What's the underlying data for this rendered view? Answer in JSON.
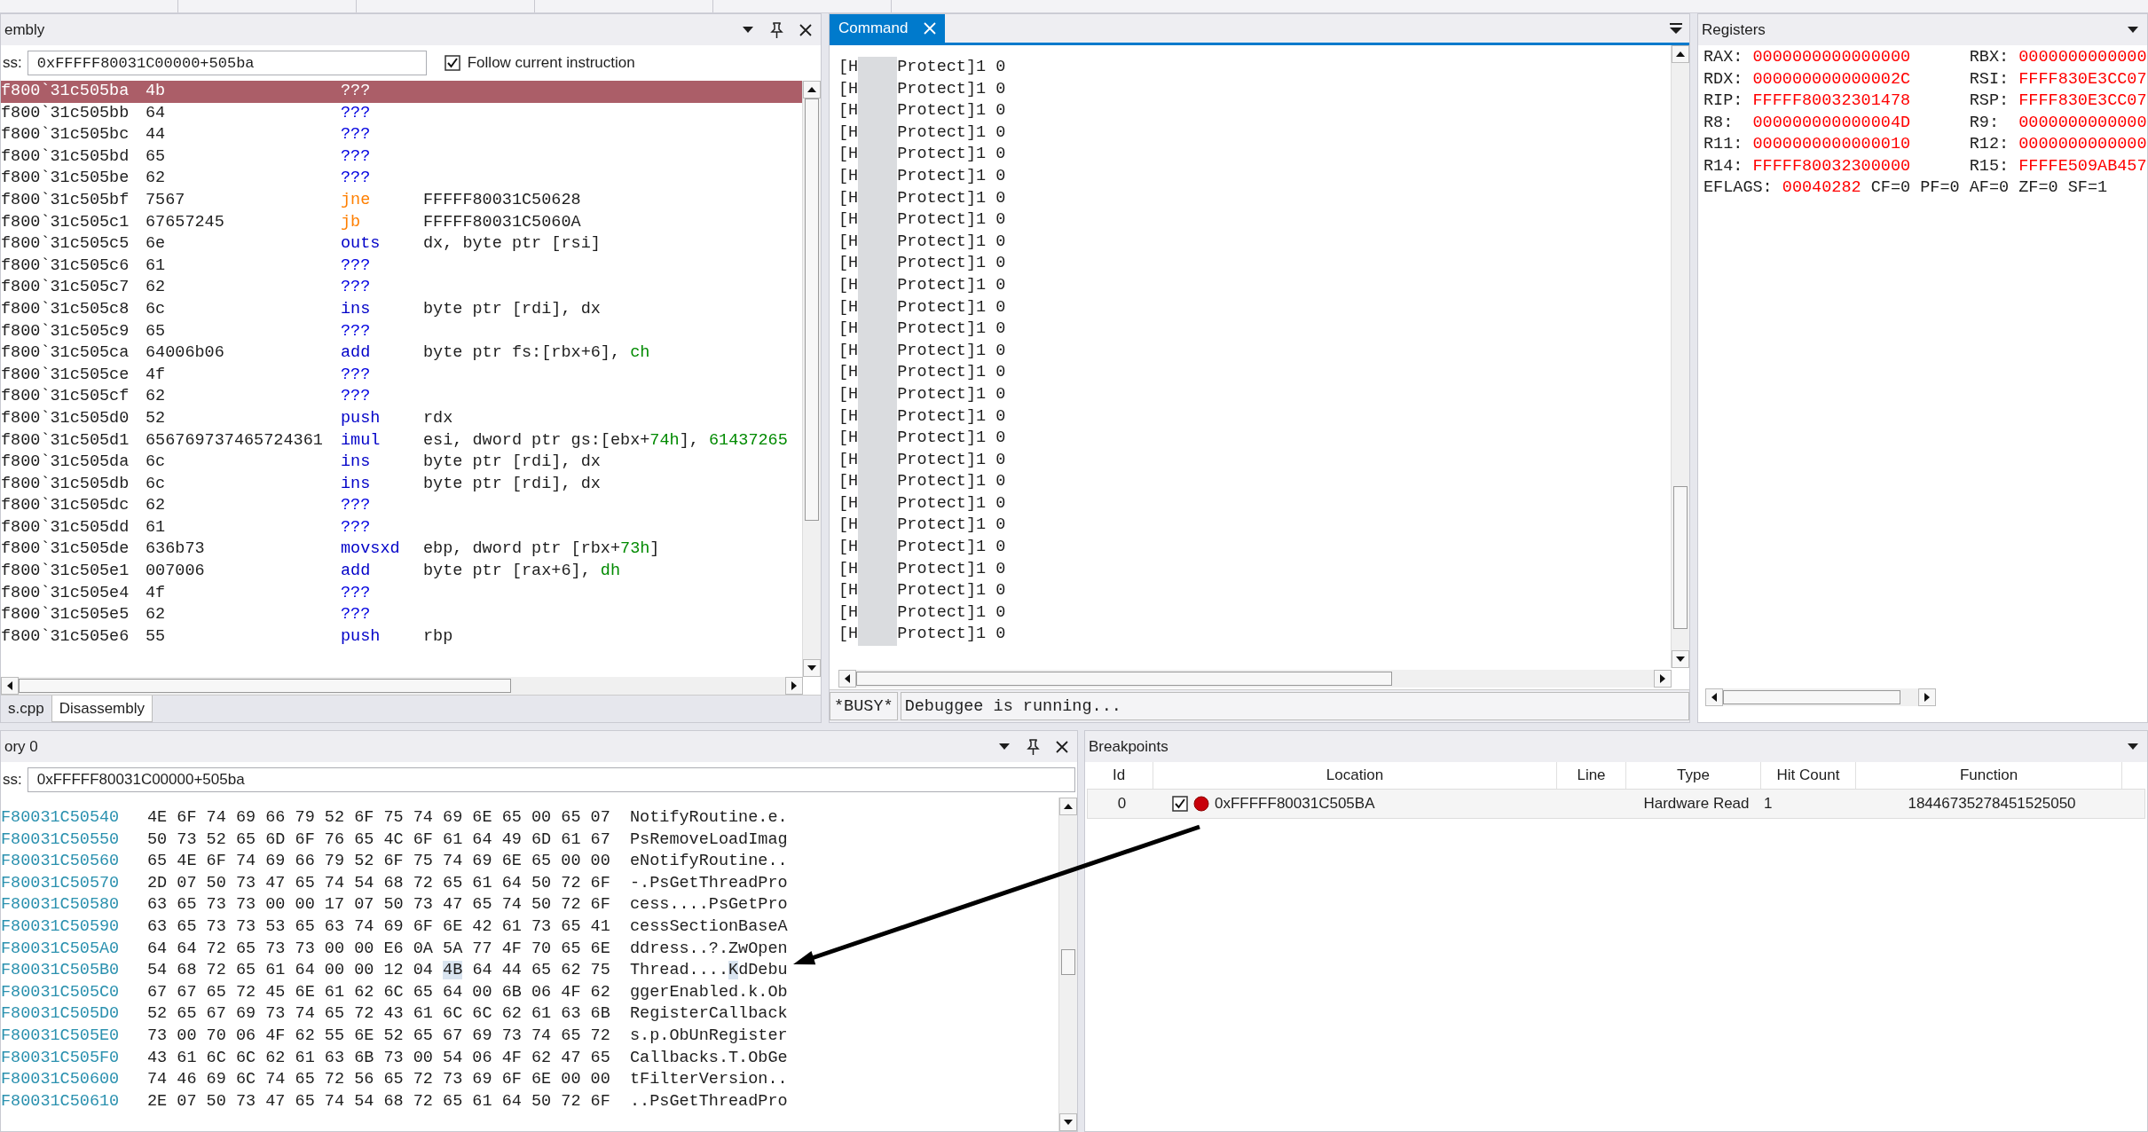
{
  "disassembly": {
    "title": "embly",
    "address_label": "ss:",
    "address": "0xFFFFF80031C00000+505ba",
    "follow": {
      "label": "Follow current instruction",
      "checked": true
    },
    "rows": [
      {
        "address": "f800`31c505ba",
        "bytes": "4b",
        "mnemonic": "???",
        "kind": "unknown",
        "selected": true
      },
      {
        "address": "f800`31c505bb",
        "bytes": "64",
        "mnemonic": "???",
        "kind": "unknown",
        "selected": false
      },
      {
        "address": "f800`31c505bc",
        "bytes": "44",
        "mnemonic": "???",
        "kind": "unknown",
        "selected": false
      },
      {
        "address": "f800`31c505bd",
        "bytes": "65",
        "mnemonic": "???",
        "kind": "unknown",
        "selected": false
      },
      {
        "address": "f800`31c505be",
        "bytes": "62",
        "mnemonic": "???",
        "kind": "unknown",
        "selected": false
      },
      {
        "address": "f800`31c505bf",
        "bytes": "7567",
        "mnemonic": "jne",
        "kind": "jump",
        "operands": [
          {
            "text": "FFFFF80031C50628",
            "kind": "plain"
          }
        ],
        "selected": false
      },
      {
        "address": "f800`31c505c1",
        "bytes": "67657245",
        "mnemonic": "jb",
        "kind": "jump",
        "operands": [
          {
            "text": "FFFFF80031C5060A",
            "kind": "plain"
          }
        ],
        "selected": false
      },
      {
        "address": "f800`31c505c5",
        "bytes": "6e",
        "mnemonic": "outs",
        "kind": "op",
        "operands": [
          {
            "text": "dx, byte ptr [rsi]",
            "kind": "plain"
          }
        ],
        "selected": false
      },
      {
        "address": "f800`31c505c6",
        "bytes": "61",
        "mnemonic": "???",
        "kind": "unknown",
        "selected": false
      },
      {
        "address": "f800`31c505c7",
        "bytes": "62",
        "mnemonic": "???",
        "kind": "unknown",
        "selected": false
      },
      {
        "address": "f800`31c505c8",
        "bytes": "6c",
        "mnemonic": "ins",
        "kind": "op",
        "operands": [
          {
            "text": "byte ptr [rdi], dx",
            "kind": "plain"
          }
        ],
        "selected": false
      },
      {
        "address": "f800`31c505c9",
        "bytes": "65",
        "mnemonic": "???",
        "kind": "unknown",
        "selected": false
      },
      {
        "address": "f800`31c505ca",
        "bytes": "64006b06",
        "mnemonic": "add",
        "kind": "op",
        "operands": [
          {
            "text": "byte ptr fs:[rbx+6], ",
            "kind": "plain"
          },
          {
            "text": "ch",
            "kind": "accent"
          }
        ],
        "selected": false
      },
      {
        "address": "f800`31c505ce",
        "bytes": "4f",
        "mnemonic": "???",
        "kind": "unknown",
        "selected": false
      },
      {
        "address": "f800`31c505cf",
        "bytes": "62",
        "mnemonic": "???",
        "kind": "unknown",
        "selected": false
      },
      {
        "address": "f800`31c505d0",
        "bytes": "52",
        "mnemonic": "push",
        "kind": "op",
        "operands": [
          {
            "text": "rdx",
            "kind": "plain"
          }
        ],
        "selected": false
      },
      {
        "address": "f800`31c505d1",
        "bytes": "656769737465724361",
        "mnemonic": "imul",
        "kind": "op",
        "operands": [
          {
            "text": "esi, dword ptr gs:[ebx+",
            "kind": "plain"
          },
          {
            "text": "74h",
            "kind": "accent"
          },
          {
            "text": "], ",
            "kind": "plain"
          },
          {
            "text": "61437265",
            "kind": "accent"
          }
        ],
        "selected": false
      },
      {
        "address": "f800`31c505da",
        "bytes": "6c",
        "mnemonic": "ins",
        "kind": "op",
        "operands": [
          {
            "text": "byte ptr [rdi], dx",
            "kind": "plain"
          }
        ],
        "selected": false
      },
      {
        "address": "f800`31c505db",
        "bytes": "6c",
        "mnemonic": "ins",
        "kind": "op",
        "operands": [
          {
            "text": "byte ptr [rdi], dx",
            "kind": "plain"
          }
        ],
        "selected": false
      },
      {
        "address": "f800`31c505dc",
        "bytes": "62",
        "mnemonic": "???",
        "kind": "unknown",
        "selected": false
      },
      {
        "address": "f800`31c505dd",
        "bytes": "61",
        "mnemonic": "???",
        "kind": "unknown",
        "selected": false
      },
      {
        "address": "f800`31c505de",
        "bytes": "636b73",
        "mnemonic": "movsxd",
        "kind": "op",
        "operands": [
          {
            "text": "ebp, dword ptr [rbx+",
            "kind": "plain"
          },
          {
            "text": "73h",
            "kind": "accent"
          },
          {
            "text": "]",
            "kind": "plain"
          }
        ],
        "selected": false
      },
      {
        "address": "f800`31c505e1",
        "bytes": "007006",
        "mnemonic": "add",
        "kind": "op",
        "operands": [
          {
            "text": "byte ptr [rax+6], ",
            "kind": "plain"
          },
          {
            "text": "dh",
            "kind": "accent"
          }
        ],
        "selected": false
      },
      {
        "address": "f800`31c505e4",
        "bytes": "4f",
        "mnemonic": "???",
        "kind": "unknown",
        "selected": false
      },
      {
        "address": "f800`31c505e5",
        "bytes": "62",
        "mnemonic": "???",
        "kind": "unknown",
        "selected": false
      },
      {
        "address": "f800`31c505e6",
        "bytes": "55",
        "mnemonic": "push",
        "kind": "op",
        "operands": [
          {
            "text": "rbp",
            "kind": "plain"
          }
        ],
        "selected": false
      }
    ],
    "tabs": [
      {
        "label": "s.cpp",
        "selected": false
      },
      {
        "label": "Disassembly",
        "selected": true
      }
    ]
  },
  "command": {
    "tab": {
      "label": "Command",
      "selected": true
    },
    "lines": [
      {
        "start": "[H",
        "end": "Protect]1 0"
      },
      {
        "start": "[H",
        "end": "Protect]1 0"
      },
      {
        "start": "[H",
        "end": "Protect]1 0"
      },
      {
        "start": "[H",
        "end": "Protect]1 0"
      },
      {
        "start": "[H",
        "end": "Protect]1 0"
      },
      {
        "start": "[H",
        "end": "Protect]1 0"
      },
      {
        "start": "[H",
        "end": "Protect]1 0"
      },
      {
        "start": "[H",
        "end": "Protect]1 0"
      },
      {
        "start": "[H",
        "end": "Protect]1 0"
      },
      {
        "start": "[H",
        "end": "Protect]1 0"
      },
      {
        "start": "[H",
        "end": "Protect]1 0"
      },
      {
        "start": "[H",
        "end": "Protect]1 0"
      },
      {
        "start": "[H",
        "end": "Protect]1 0"
      },
      {
        "start": "[H",
        "end": "Protect]1 0"
      },
      {
        "start": "[H",
        "end": "Protect]1 0"
      },
      {
        "start": "[H",
        "end": "Protect]1 0"
      },
      {
        "start": "[H",
        "end": "Protect]1 0"
      },
      {
        "start": "[H",
        "end": "Protect]1 0"
      },
      {
        "start": "[H",
        "end": "Protect]1 0"
      },
      {
        "start": "[H",
        "end": "Protect]1 0"
      },
      {
        "start": "[H",
        "end": "Protect]1 0"
      },
      {
        "start": "[H",
        "end": "Protect]1 0"
      },
      {
        "start": "[H",
        "end": "Protect]1 0"
      },
      {
        "start": "[H",
        "end": "Protect]1 0"
      },
      {
        "start": "[H",
        "end": "Protect]1 0"
      },
      {
        "start": "[H",
        "end": "Protect]1 0"
      },
      {
        "start": "[H",
        "end": "Protect]1 0"
      }
    ],
    "status": "*BUSY*",
    "message": "Debuggee is running..."
  },
  "registers": {
    "title": "Registers",
    "rows": [
      [
        {
          "name": "RAX:",
          "value": "0000000000000000"
        },
        {
          "name": "RBX:",
          "value": "0000000000000"
        }
      ],
      [
        {
          "name": "RDX:",
          "value": "000000000000002C"
        },
        {
          "name": "RSI:",
          "value": "FFFF830E3CC07"
        }
      ],
      [
        {
          "name": "RIP:",
          "value": "FFFFF80032301478"
        },
        {
          "name": "RSP:",
          "value": "FFFF830E3CC07"
        }
      ],
      [
        {
          "name": "R8:",
          "value": "000000000000004D"
        },
        {
          "name": "R9:",
          "value": "0000000000000"
        }
      ],
      [
        {
          "name": "R11:",
          "value": "0000000000000010"
        },
        {
          "name": "R12:",
          "value": "0000000000000"
        }
      ],
      [
        {
          "name": "R14:",
          "value": "FFFFF80032300000"
        },
        {
          "name": "R15:",
          "value": "FFFFE509AB457"
        }
      ]
    ],
    "eflags": {
      "name": "EFLAGS:",
      "value": "00040282",
      "flags": "CF=0 PF=0 AF=0 ZF=0 SF=1"
    }
  },
  "memory": {
    "title": "ory 0",
    "address_label": "ss:",
    "address": "0xFFFFF80031C00000+505ba",
    "rows": [
      {
        "address": "F80031C50540",
        "bytes": "4E 6F 74 69 66 79 52 6F 75 74 69 6E 65 00 65 07",
        "ascii": "NotifyRoutine.e."
      },
      {
        "address": "F80031C50550",
        "bytes": "50 73 52 65 6D 6F 76 65 4C 6F 61 64 49 6D 61 67",
        "ascii": "PsRemoveLoadImag"
      },
      {
        "address": "F80031C50560",
        "bytes": "65 4E 6F 74 69 66 79 52 6F 75 74 69 6E 65 00 00",
        "ascii": "eNotifyRoutine.."
      },
      {
        "address": "F80031C50570",
        "bytes": "2D 07 50 73 47 65 74 54 68 72 65 61 64 50 72 6F",
        "ascii": "-.PsGetThreadPro"
      },
      {
        "address": "F80031C50580",
        "bytes": "63 65 73 73 00 00 17 07 50 73 47 65 74 50 72 6F",
        "ascii": "cess....PsGetPro"
      },
      {
        "address": "F80031C50590",
        "bytes": "63 65 73 73 53 65 63 74 69 6F 6E 42 61 73 65 41",
        "ascii": "cessSectionBaseA"
      },
      {
        "address": "F80031C505A0",
        "bytes": "64 64 72 65 73 73 00 00 E6 0A 5A 77 4F 70 65 6E",
        "ascii": "ddress..?.ZwOpen"
      },
      {
        "address": "F80031C505B0",
        "bytes": "54 68 72 65 61 64 00 00 12 04",
        "cursor_byte": "4B",
        "bytes_after": "64 44 65 62 75",
        "ascii": "Thread....",
        "cursor_char": "K",
        "ascii_after": "dDebu"
      },
      {
        "address": "F80031C505C0",
        "bytes": "67 67 65 72 45 6E 61 62 6C 65 64 00 6B 06 4F 62",
        "ascii": "ggerEnabled.k.Ob"
      },
      {
        "address": "F80031C505D0",
        "bytes": "52 65 67 69 73 74 65 72 43 61 6C 6C 62 61 63 6B",
        "ascii": "RegisterCallback"
      },
      {
        "address": "F80031C505E0",
        "bytes": "73 00 70 06 4F 62 55 6E 52 65 67 69 73 74 65 72",
        "ascii": "s.p.ObUnRegister"
      },
      {
        "address": "F80031C505F0",
        "bytes": "43 61 6C 6C 62 61 63 6B 73 00 54 06 4F 62 47 65",
        "ascii": "Callbacks.T.ObGe"
      },
      {
        "address": "F80031C50600",
        "bytes": "74 46 69 6C 74 65 72 56 65 72 73 69 6F 6E 00 00",
        "ascii": "tFilterVersion.."
      },
      {
        "address": "F80031C50610",
        "bytes": "2E 07 50 73 47 65 74 54 68 72 65 61 64 50 72 6F",
        "ascii": "..PsGetThreadPro"
      }
    ]
  },
  "breakpoints": {
    "title": "Breakpoints",
    "columns": [
      "Id",
      "Location",
      "Line",
      "Type",
      "Hit Count",
      "Function"
    ],
    "rows": [
      {
        "id": "0",
        "checked": true,
        "location": "0xFFFFF80031C505BA",
        "type": "Hardware Read",
        "hit_count": "1",
        "function": "18446735278451525050"
      }
    ]
  }
}
